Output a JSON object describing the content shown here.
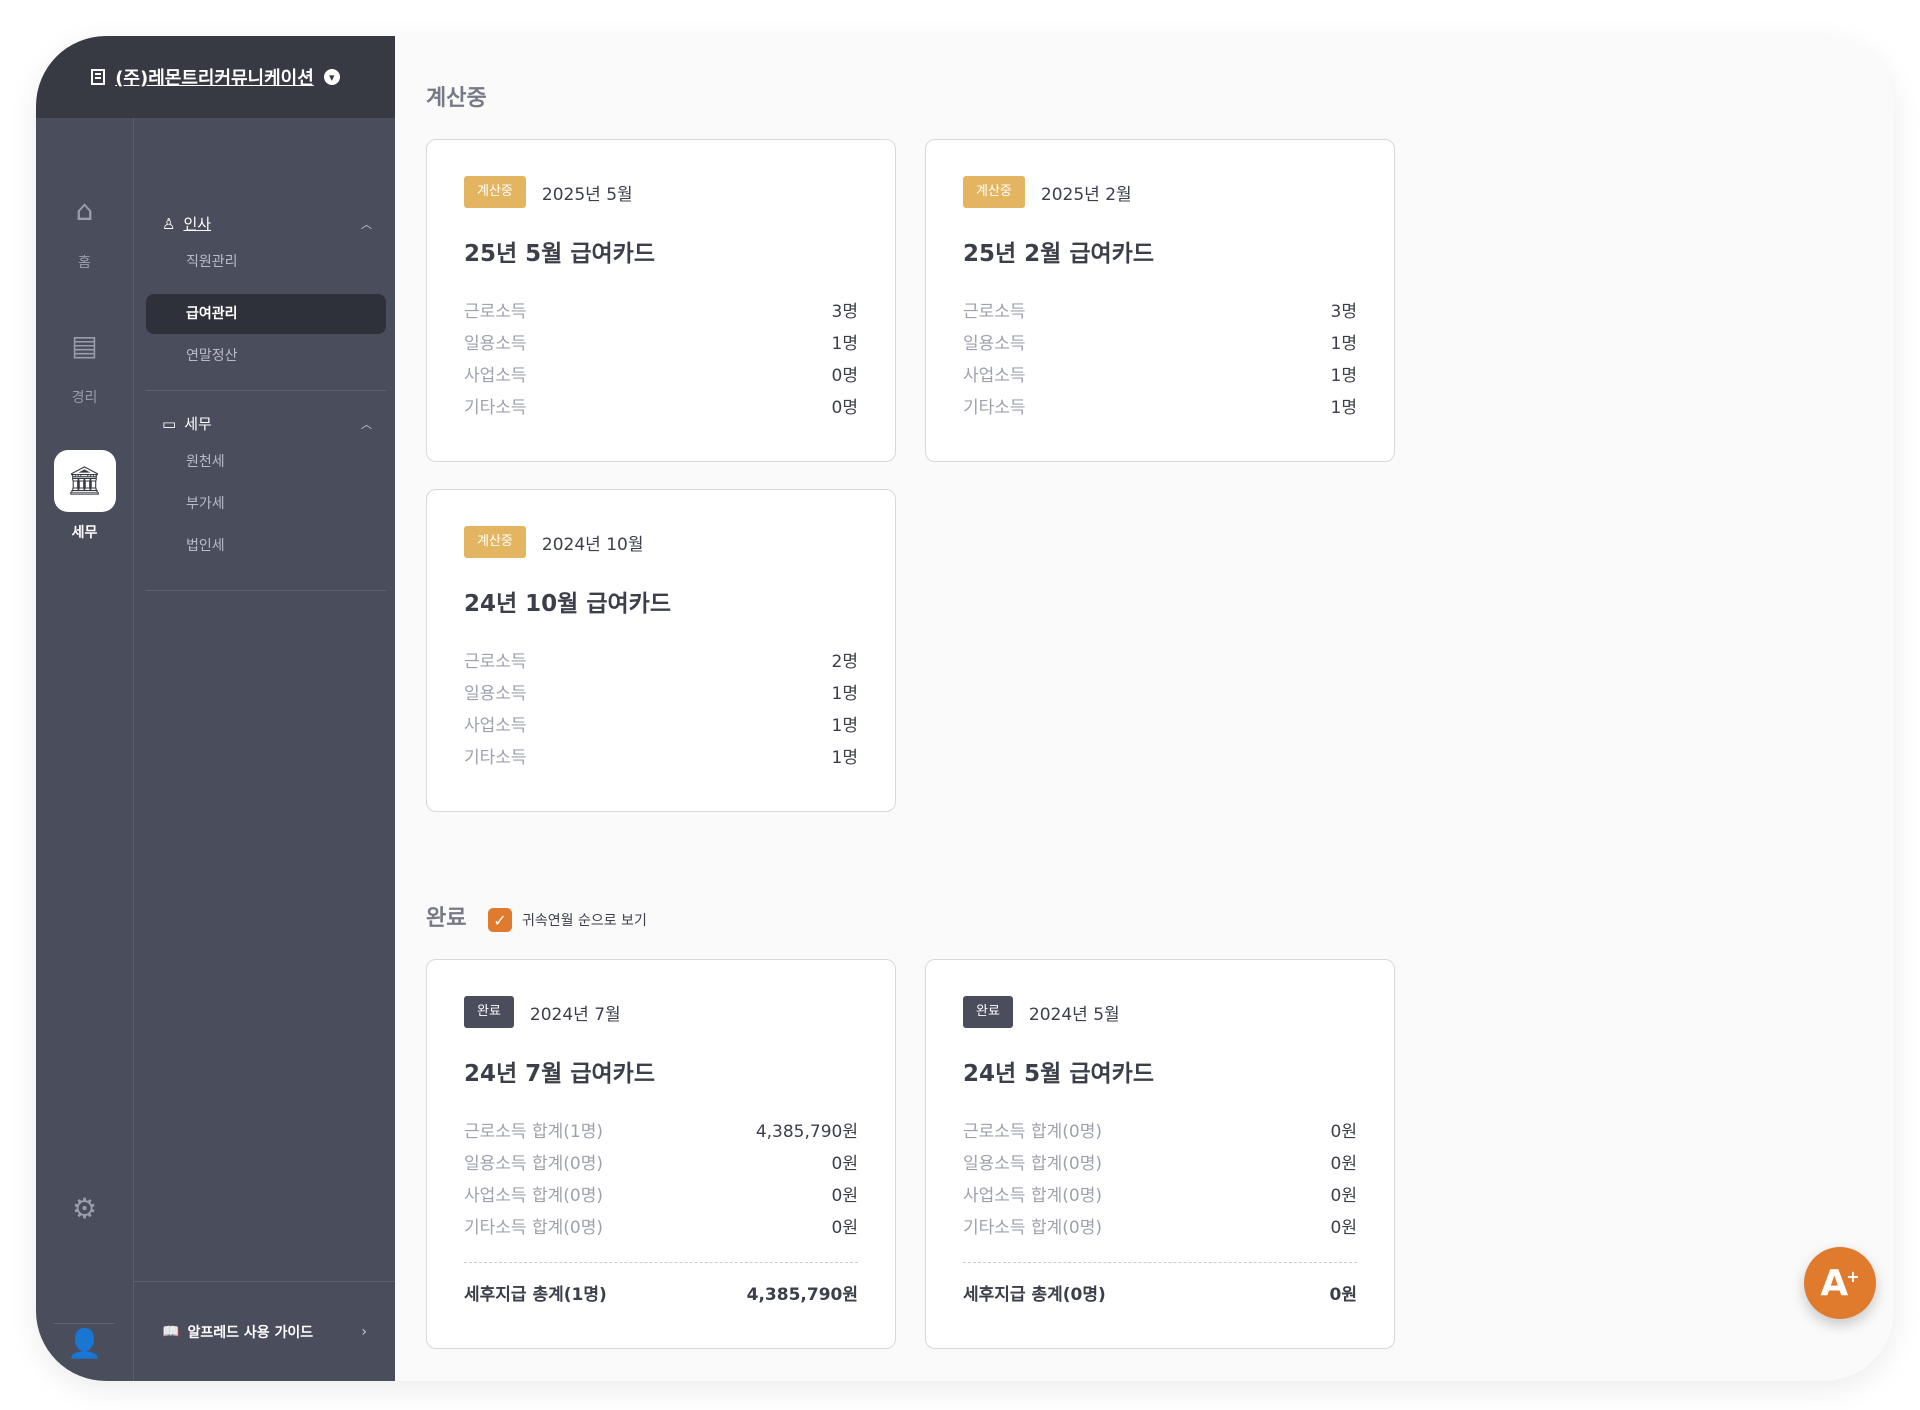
{
  "header": {
    "company": "(주)레몬트리커뮤니케이션"
  },
  "rail": {
    "items": [
      {
        "label": "홈"
      },
      {
        "label": "경리"
      },
      {
        "label": "세무"
      }
    ]
  },
  "sidebar": {
    "hr": {
      "label": "인사",
      "items": [
        "직원관리",
        "급여관리",
        "연말정산"
      ]
    },
    "tax": {
      "label": "세무",
      "items": [
        "원천세",
        "부가세",
        "법인세"
      ]
    },
    "guide": "알프레드 사용 가이드"
  },
  "calculating": {
    "title": "계산중",
    "cards": [
      {
        "badge": "계산중",
        "period": "2025년 5월",
        "title": "25년 5월 급여카드",
        "rows": [
          {
            "k": "근로소득",
            "v": "3명"
          },
          {
            "k": "일용소득",
            "v": "1명"
          },
          {
            "k": "사업소득",
            "v": "0명"
          },
          {
            "k": "기타소득",
            "v": "0명"
          }
        ]
      },
      {
        "badge": "계산중",
        "period": "2025년 2월",
        "title": "25년 2월 급여카드",
        "rows": [
          {
            "k": "근로소득",
            "v": "3명"
          },
          {
            "k": "일용소득",
            "v": "1명"
          },
          {
            "k": "사업소득",
            "v": "1명"
          },
          {
            "k": "기타소득",
            "v": "1명"
          }
        ]
      },
      {
        "badge": "계산중",
        "period": "2024년 10월",
        "title": "24년 10월 급여카드",
        "rows": [
          {
            "k": "근로소득",
            "v": "2명"
          },
          {
            "k": "일용소득",
            "v": "1명"
          },
          {
            "k": "사업소득",
            "v": "1명"
          },
          {
            "k": "기타소득",
            "v": "1명"
          }
        ]
      }
    ]
  },
  "completed": {
    "title": "완료",
    "checkbox_label": "귀속연월 순으로 보기",
    "checkbox_checked": true,
    "cards": [
      {
        "badge": "완료",
        "period": "2024년 7월",
        "title": "24년 7월 급여카드",
        "rows": [
          {
            "k": "근로소득 합계(1명)",
            "v": "4,385,790원"
          },
          {
            "k": "일용소득 합계(0명)",
            "v": "0원"
          },
          {
            "k": "사업소득 합계(0명)",
            "v": "0원"
          },
          {
            "k": "기타소득 합계(0명)",
            "v": "0원"
          }
        ],
        "total_k": "세후지급 총계(1명)",
        "total_v": "4,385,790원"
      },
      {
        "badge": "완료",
        "period": "2024년 5월",
        "title": "24년 5월 급여카드",
        "rows": [
          {
            "k": "근로소득 합계(0명)",
            "v": "0원"
          },
          {
            "k": "일용소득 합계(0명)",
            "v": "0원"
          },
          {
            "k": "사업소득 합계(0명)",
            "v": "0원"
          },
          {
            "k": "기타소득 합계(0명)",
            "v": "0원"
          }
        ],
        "total_k": "세후지급 총계(0명)",
        "total_v": "0원"
      }
    ]
  },
  "colors": {
    "accent": "#e07a2d",
    "calc_badge": "#e4b560",
    "done_badge": "#4a4d5b",
    "sidebar": "#4a4d5b"
  }
}
